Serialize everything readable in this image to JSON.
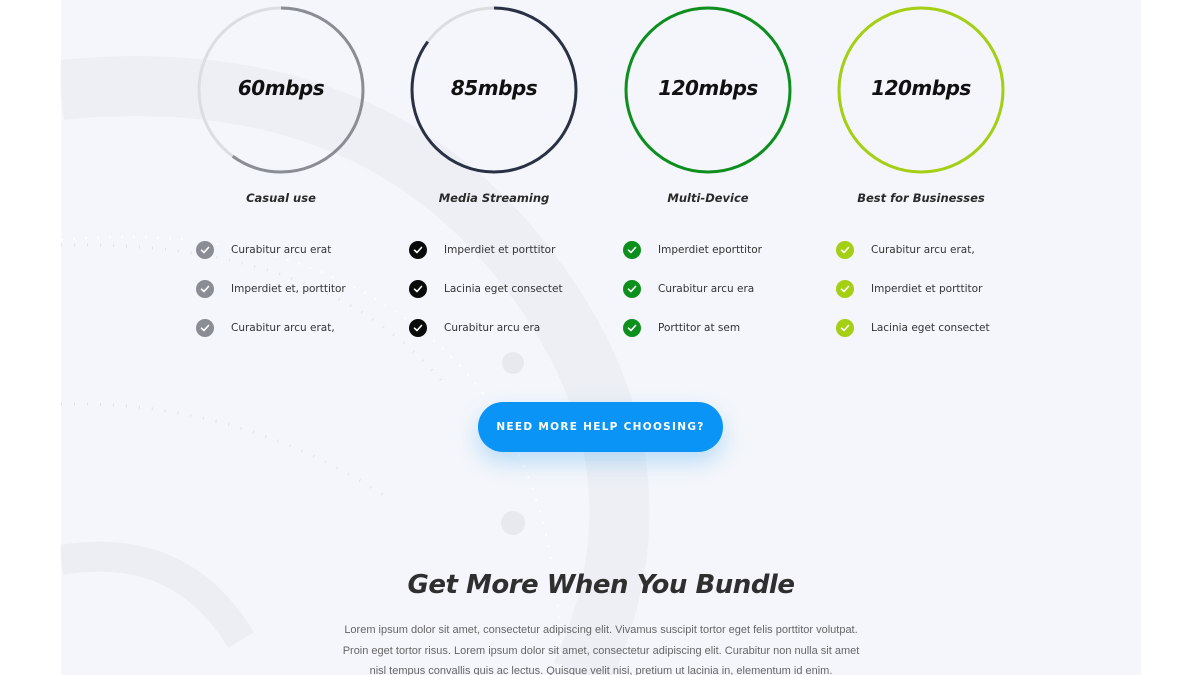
{
  "plans": [
    {
      "speed": "60mbps",
      "name": "Casual use",
      "color": "#8a8d94",
      "progress": 0.6,
      "features": [
        "Curabitur arcu erat",
        "Imperdiet et, porttitor",
        "Curabitur arcu erat,"
      ]
    },
    {
      "speed": "85mbps",
      "name": "Media Streaming",
      "color": "#2b3145",
      "progress": 0.85,
      "features": [
        "Imperdiet et porttitor",
        "Lacinia eget consectet",
        "Curabitur arcu era"
      ]
    },
    {
      "speed": "120mbps",
      "name": "Multi-Device",
      "color": "#0d8f1e",
      "progress": 1.0,
      "features": [
        "Imperdiet eporttitor",
        "Curabitur arcu era",
        "Porttitor at sem"
      ]
    },
    {
      "speed": "120mbps",
      "name": "Best for Businesses",
      "color": "#a4cf12",
      "progress": 1.0,
      "features": [
        "Curabitur arcu erat,",
        "Imperdiet et porttitor",
        "Lacinia eget consectet"
      ]
    }
  ],
  "feature_check_colors": [
    "#8a8d94",
    "#0a0a0a",
    "#0d8f1e",
    "#a4cf12"
  ],
  "cta": {
    "label": "NEED MORE HELP CHOOSING?",
    "color": "#0a94f5"
  },
  "bundle": {
    "title": "Get More When You Bundle",
    "lines": [
      "Lorem ipsum dolor sit amet, consectetur adipiscing elit. Vivamus suscipit tortor eget felis porttitor volutpat.",
      "Proin eget tortor risus. Lorem ipsum dolor sit amet, consectetur adipiscing elit. Curabitur non nulla sit amet",
      "nisl tempus convallis quis ac lectus. Quisque velit nisi, pretium ut lacinia in, elementum id enim."
    ]
  }
}
